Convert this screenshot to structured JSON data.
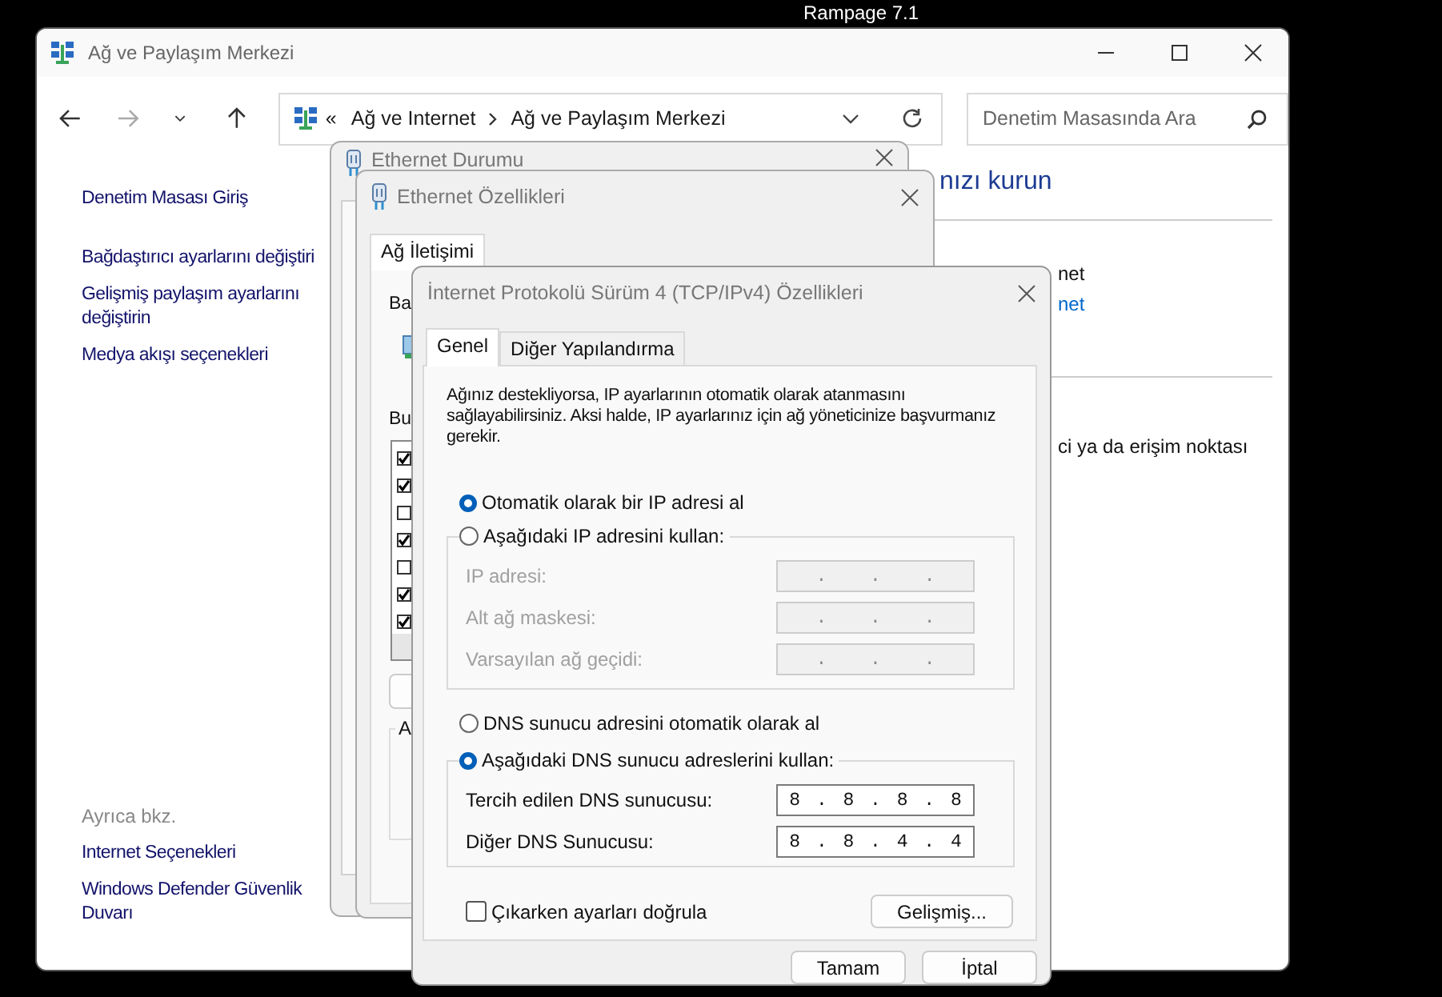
{
  "desktop_label": {
    "lines": [
      "Rampage 7.1"
    ]
  },
  "main_window": {
    "title": "Ağ ve Paylaşım Merkezi",
    "nav_buttons": [
      {
        "kind": "back",
        "disabled": false
      },
      {
        "kind": "forward",
        "disabled": true
      },
      {
        "kind": "recent",
        "disabled": false
      },
      {
        "kind": "up",
        "disabled": false
      }
    ],
    "address": {
      "overflow_mark": "«",
      "crumbs": [
        "Ağ ve Internet",
        "Ağ ve Paylaşım Merkezi"
      ]
    },
    "search": {
      "placeholder": "Denetim Masasında Ara"
    },
    "sidebar": {
      "links": [
        "Denetim Masası Giriş",
        "Bağdaştırıcı ayarlarını değiştiri",
        "Gelişmiş paylaşım ayarlarını değiştirin",
        "Medya akışı seçenekleri"
      ],
      "see_also_title": "Ayrıca bkz.",
      "see_also": [
        "Internet Seçenekleri",
        "Windows Defender Güvenlik Duvarı"
      ]
    },
    "content": {
      "heading": "nızı kurun",
      "sections": [
        [
          {
            "kind": "text",
            "text": "net"
          },
          {
            "kind": "link",
            "text": "net"
          }
        ],
        [
          {
            "kind": "text",
            "text": "ci ya da erişim noktası"
          }
        ]
      ]
    }
  },
  "status_window": {
    "title": "Ethernet Durumu"
  },
  "properties_window": {
    "title": "Ethernet Özellikleri",
    "tabs": [
      {
        "label": "Ağ İletişimi",
        "selected": true
      }
    ],
    "connect_label": "Ba",
    "list_label": "Bu",
    "components": [
      {
        "checked": true
      },
      {
        "checked": true
      },
      {
        "checked": false
      },
      {
        "checked": true
      },
      {
        "checked": false
      },
      {
        "checked": true
      },
      {
        "checked": true
      }
    ],
    "group_label": "A"
  },
  "ipv4_dialog": {
    "title": "İnternet Protokolü Sürüm 4 (TCP/IPv4) Özellikleri",
    "tabs": [
      {
        "label": "Genel",
        "selected": true
      },
      {
        "label": "Diğer Yapılandırma",
        "selected": false
      }
    ],
    "intro": "Ağınız destekliyorsa, IP ayarlarının otomatik olarak atanmasını sağlayabilirsiniz. Aksi halde, IP ayarlarınız için ağ yöneticinize başvurmanız gerekir.",
    "ip_options": [
      {
        "label": "Otomatik olarak bir IP adresi al",
        "selected": true
      },
      {
        "label": "Aşağıdaki IP adresini kullan:",
        "selected": false
      }
    ],
    "ip_fields": [
      {
        "label": "IP adresi:",
        "value": ". . .",
        "disabled": true
      },
      {
        "label": "Alt ağ maskesi:",
        "value": ". . .",
        "disabled": true
      },
      {
        "label": "Varsayılan ağ geçidi:",
        "value": ". . .",
        "disabled": true
      }
    ],
    "dns_options": [
      {
        "label": "DNS sunucu adresini otomatik olarak al",
        "selected": false
      },
      {
        "label": "Aşağıdaki DNS sunucu adreslerini kullan:",
        "selected": true
      }
    ],
    "dns_fields": [
      {
        "label": "Tercih edilen DNS sunucusu:",
        "value": "8 . 8 . 8 . 8",
        "disabled": false
      },
      {
        "label": "Diğer DNS Sunucusu:",
        "value": "8 . 8 . 4 . 4",
        "disabled": false
      }
    ],
    "validate": {
      "label": "Çıkarken ayarları doğrula",
      "checked": false
    },
    "advanced_button": "Gelişmiş...",
    "buttons": [
      "Tamam",
      "İptal"
    ]
  }
}
